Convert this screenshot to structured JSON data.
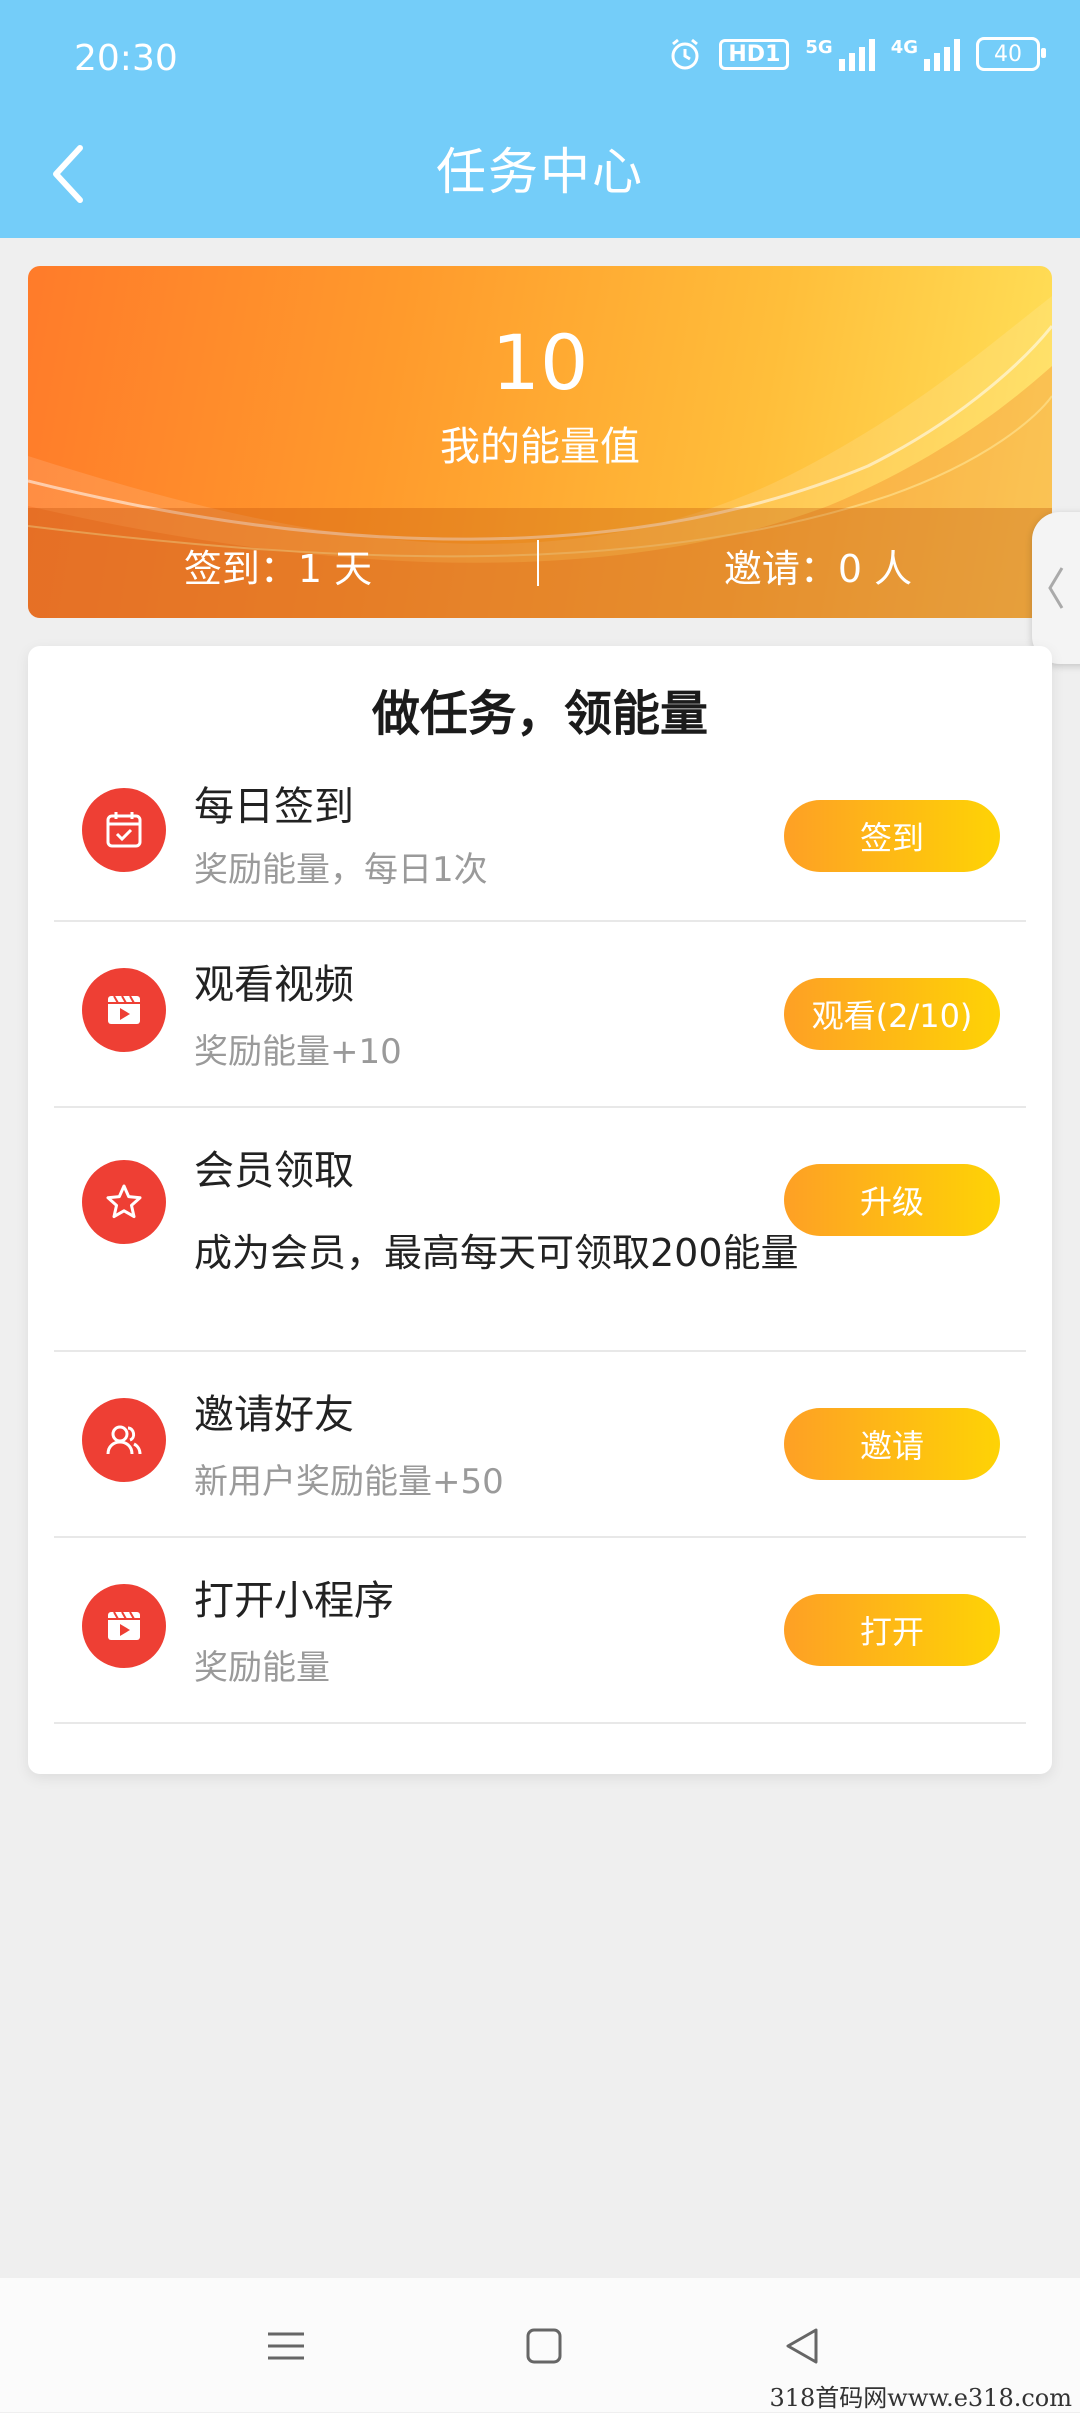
{
  "status": {
    "time": "20:30",
    "hd": "HD1",
    "net1": "5G",
    "net2": "4G",
    "battery": "40"
  },
  "header": {
    "title": "任务中心"
  },
  "energy": {
    "value": "10",
    "label": "我的能量值",
    "signin": "签到：1 天",
    "invites": "邀请：0 人"
  },
  "tasks": {
    "heading": "做任务，领能量",
    "items": [
      {
        "name": "每日签到",
        "desc": "奖励能量，每日1次",
        "button": "签到",
        "icon": "calendar-icon"
      },
      {
        "name": "观看视频",
        "desc": "奖励能量+10",
        "button": "观看(2/10)",
        "icon": "video-icon"
      },
      {
        "name": "会员领取",
        "desc": "成为会员，最高每天可领取200能量",
        "button": "升级",
        "icon": "star-icon"
      },
      {
        "name": "邀请好友",
        "desc": "新用户奖励能量+50",
        "button": "邀请",
        "icon": "users-icon"
      },
      {
        "name": "打开小程序",
        "desc": "奖励能量",
        "button": "打开",
        "icon": "video-icon"
      }
    ]
  },
  "watermark": "318首码网www.e318.com",
  "colors": {
    "header": "#74cdf9",
    "accent_red": "#ee3f34",
    "button_start": "#fea025",
    "button_end": "#fed305"
  }
}
